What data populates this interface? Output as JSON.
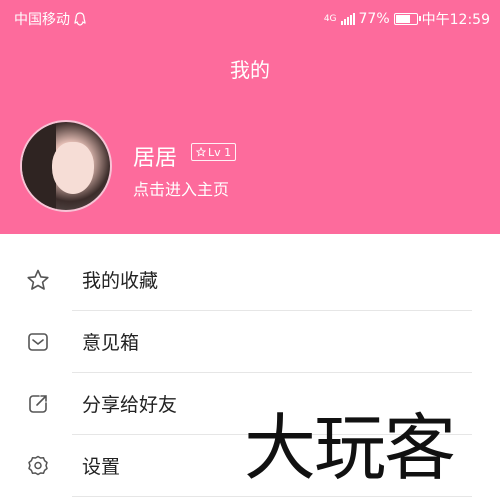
{
  "status_bar": {
    "carrier": "中国移动",
    "network": "4G",
    "battery": "77%",
    "battery_level": 0.77,
    "time": "中午12:59"
  },
  "header": {
    "title": "我的",
    "bg_color": "#fd6b9c",
    "profile": {
      "name": "居居",
      "level": "Lv 1",
      "homepage_link": "点击进入主页"
    }
  },
  "menu": {
    "items": [
      {
        "label": "我的收藏",
        "icon": "star-icon"
      },
      {
        "label": "意见箱",
        "icon": "mail-icon"
      },
      {
        "label": "分享给好友",
        "icon": "share-icon"
      },
      {
        "label": "设置",
        "icon": "gear-icon"
      }
    ]
  },
  "watermark": "大玩客"
}
